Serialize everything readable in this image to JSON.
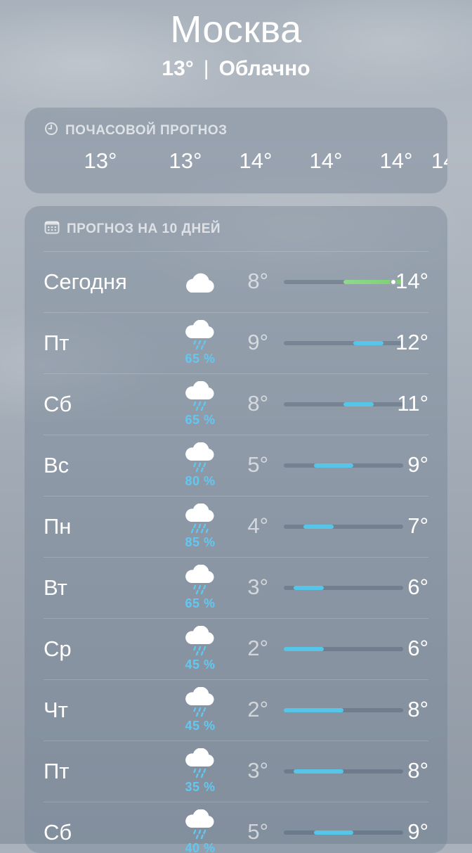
{
  "location": {
    "city": "Москва",
    "temperature": "13°",
    "separator": "|",
    "condition": "Облачно"
  },
  "hourly": {
    "title": "ПОЧАСОВОЙ ПРОГНОЗ",
    "icon": "clock-icon",
    "temps": [
      "13°",
      "13°",
      "14°",
      "14°",
      "14°",
      "14"
    ]
  },
  "forecast": {
    "title": "ПРОГНОЗ НА 10 ДНЕЙ",
    "icon": "calendar-icon",
    "range_scale": {
      "min": 2,
      "max": 14
    },
    "colors": {
      "today_bar": "#7ccf6f",
      "bar": "#55c6e8",
      "precip": "#62c8f2"
    },
    "days": [
      {
        "day": "Сегодня",
        "icon": "cloud-icon",
        "precip": "",
        "low": "8°",
        "high": "14°",
        "low_val": 8,
        "high_val": 14,
        "current_val": 13,
        "today": true
      },
      {
        "day": "Пт",
        "icon": "rain-cloud-icon",
        "precip": "65 %",
        "low": "9°",
        "high": "12°",
        "low_val": 9,
        "high_val": 12
      },
      {
        "day": "Сб",
        "icon": "rain-cloud-icon",
        "precip": "65 %",
        "low": "8°",
        "high": "11°",
        "low_val": 8,
        "high_val": 11
      },
      {
        "day": "Вс",
        "icon": "rain-cloud-icon",
        "precip": "80 %",
        "low": "5°",
        "high": "9°",
        "low_val": 5,
        "high_val": 9
      },
      {
        "day": "Пн",
        "icon": "heavy-rain-cloud-icon",
        "precip": "85 %",
        "low": "4°",
        "high": "7°",
        "low_val": 4,
        "high_val": 7
      },
      {
        "day": "Вт",
        "icon": "rain-cloud-icon",
        "precip": "65 %",
        "low": "3°",
        "high": "6°",
        "low_val": 3,
        "high_val": 6
      },
      {
        "day": "Ср",
        "icon": "rain-cloud-icon",
        "precip": "45 %",
        "low": "2°",
        "high": "6°",
        "low_val": 2,
        "high_val": 6
      },
      {
        "day": "Чт",
        "icon": "rain-cloud-icon",
        "precip": "45 %",
        "low": "2°",
        "high": "8°",
        "low_val": 2,
        "high_val": 8
      },
      {
        "day": "Пт",
        "icon": "rain-cloud-icon",
        "precip": "35 %",
        "low": "3°",
        "high": "8°",
        "low_val": 3,
        "high_val": 8
      },
      {
        "day": "Сб",
        "icon": "rain-cloud-icon",
        "precip": "40 %",
        "low": "5°",
        "high": "9°",
        "low_val": 5,
        "high_val": 9
      }
    ]
  }
}
